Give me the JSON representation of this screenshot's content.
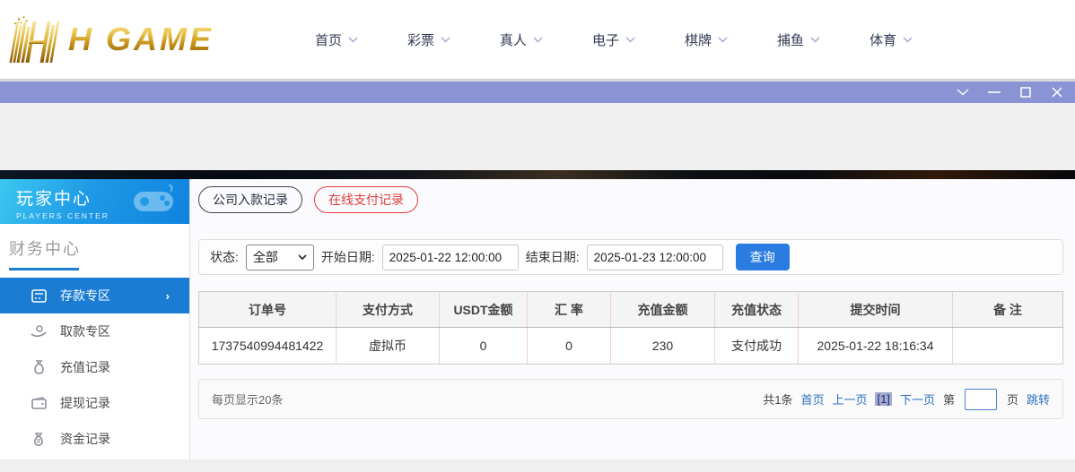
{
  "header": {
    "logo_text": "H GAME",
    "nav": [
      "首页",
      "彩票",
      "真人",
      "电子",
      "棋牌",
      "捕鱼",
      "体育"
    ]
  },
  "titlebar": {
    "controls": [
      "collapse",
      "minimize",
      "maximize",
      "close"
    ]
  },
  "sidebar": {
    "title": "玩家中心",
    "subtitle": "PLAYERS  CENTER",
    "section": "财务中心",
    "items": [
      {
        "label": "存款专区",
        "icon": "deposit-icon",
        "active": true
      },
      {
        "label": "取款专区",
        "icon": "withdraw-icon",
        "active": false
      },
      {
        "label": "充值记录",
        "icon": "recharge-records-icon",
        "active": false
      },
      {
        "label": "提现记录",
        "icon": "withdrawal-records-icon",
        "active": false
      },
      {
        "label": "资金记录",
        "icon": "funds-records-icon",
        "active": false
      }
    ]
  },
  "main": {
    "tabs": [
      {
        "label": "公司入款记录",
        "active": false
      },
      {
        "label": "在线支付记录",
        "active": true
      }
    ],
    "filters": {
      "status_label": "状态:",
      "status_value": "全部",
      "start_label": "开始日期:",
      "start_value": "2025-01-22 12:00:00",
      "end_label": "结束日期:",
      "end_value": "2025-01-23 12:00:00",
      "search_label": "查询"
    },
    "table": {
      "headers": [
        "订单号",
        "支付方式",
        "USDT金额",
        "汇 率",
        "充值金额",
        "充值状态",
        "提交时间",
        "备 注"
      ],
      "rows": [
        [
          "1737540994481422",
          "虚拟币",
          "0",
          "0",
          "230",
          "支付成功",
          "2025-01-22 18:16:34",
          ""
        ]
      ]
    },
    "pagination": {
      "page_size_text": "每页显示20条",
      "total_text": "共1条",
      "first": "首页",
      "prev": "上一页",
      "current": "[1]",
      "next": "下一页",
      "jump_pre": "第",
      "jump_post": "页",
      "jump_button": "跳转"
    }
  },
  "colors": {
    "accent_blue": "#1a7cd3",
    "button_blue": "#2b7ce0",
    "tab_red": "#e23b3b",
    "titlebar_purple": "#8a93d3",
    "logo_gold": "#d4a017",
    "link_blue": "#2d6fbe",
    "sidebar_gradient_start": "#3cc8f0",
    "sidebar_gradient_end": "#0f82de"
  }
}
